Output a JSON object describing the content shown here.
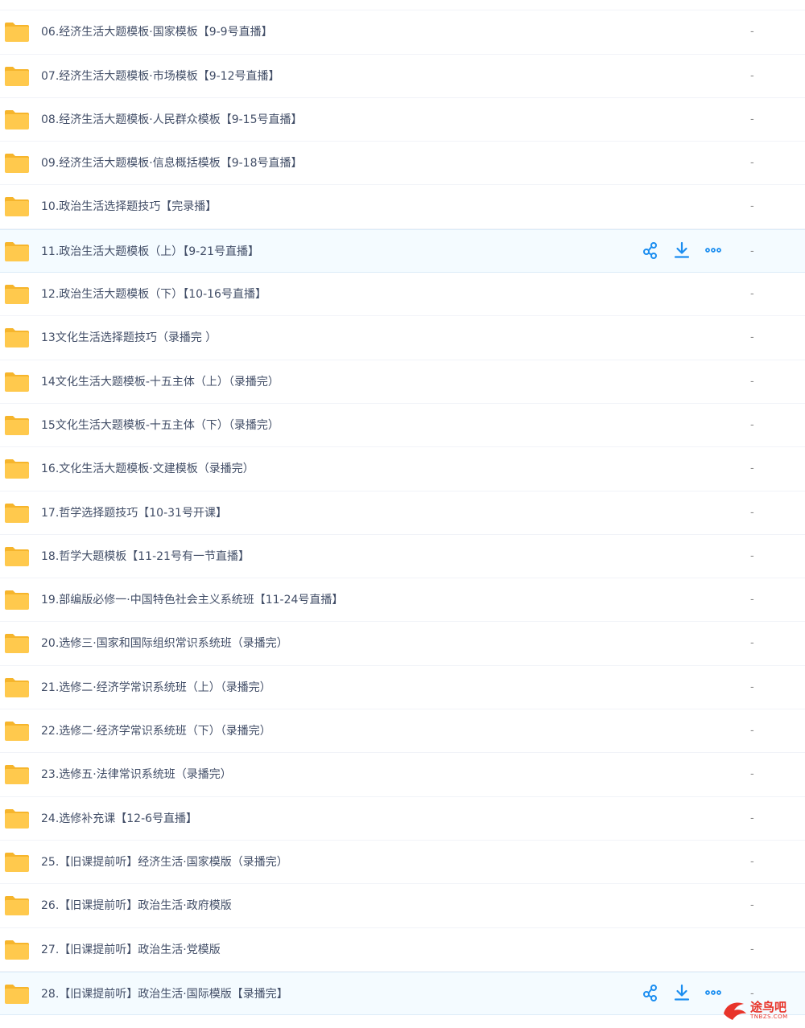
{
  "files": [
    {
      "name": "",
      "size": "",
      "icon": "folder-icon",
      "hovered": false
    },
    {
      "name": "06.经济生活大题模板·国家模板【9-9号直播】",
      "size": "-",
      "icon": "folder-icon",
      "hovered": false
    },
    {
      "name": "07.经济生活大题模板·市场模板【9-12号直播】",
      "size": "-",
      "icon": "folder-icon",
      "hovered": false
    },
    {
      "name": "08.经济生活大题模板·人民群众模板【9-15号直播】",
      "size": "-",
      "icon": "folder-icon",
      "hovered": false
    },
    {
      "name": "09.经济生活大题模板·信息概括模板【9-18号直播】",
      "size": "-",
      "icon": "folder-icon",
      "hovered": false
    },
    {
      "name": "10.政治生活选择题技巧【完录播】",
      "size": "-",
      "icon": "folder-icon",
      "hovered": false
    },
    {
      "name": "11.政治生活大题模板（上）【9-21号直播】",
      "size": "-",
      "icon": "folder-icon",
      "hovered": true
    },
    {
      "name": "12.政治生活大题模板（下）【10-16号直播】",
      "size": "-",
      "icon": "folder-icon",
      "hovered": false
    },
    {
      "name": "13文化生活选择题技巧（录播完 ）",
      "size": "-",
      "icon": "folder-icon",
      "hovered": false
    },
    {
      "name": "14文化生活大题模板-十五主体（上）（录播完）",
      "size": "-",
      "icon": "folder-icon",
      "hovered": false
    },
    {
      "name": "15文化生活大题模板-十五主体（下）（录播完）",
      "size": "-",
      "icon": "folder-icon",
      "hovered": false
    },
    {
      "name": "16.文化生活大题模板·文建模板（录播完）",
      "size": "-",
      "icon": "folder-icon",
      "hovered": false
    },
    {
      "name": "17.哲学选择题技巧【10-31号开课】",
      "size": "-",
      "icon": "folder-icon",
      "hovered": false
    },
    {
      "name": "18.哲学大题模板【11-21号有一节直播】",
      "size": "-",
      "icon": "folder-icon",
      "hovered": false
    },
    {
      "name": "19.部编版必修一·中国特色社会主义系统班【11-24号直播】",
      "size": "-",
      "icon": "folder-icon",
      "hovered": false
    },
    {
      "name": "20.选修三·国家和国际组织常识系统班（录播完）",
      "size": "-",
      "icon": "folder-icon",
      "hovered": false
    },
    {
      "name": "21.选修二·经济学常识系统班（上）（录播完）",
      "size": "-",
      "icon": "folder-icon",
      "hovered": false
    },
    {
      "name": "22.选修二·经济学常识系统班（下）（录播完）",
      "size": "-",
      "icon": "folder-icon",
      "hovered": false
    },
    {
      "name": "23.选修五·法律常识系统班（录播完）",
      "size": "-",
      "icon": "folder-icon",
      "hovered": false
    },
    {
      "name": "24.选修补充课【12-6号直播】",
      "size": "-",
      "icon": "folder-icon",
      "hovered": false
    },
    {
      "name": "25.【旧课提前听】经济生活·国家模版（录播完）",
      "size": "-",
      "icon": "folder-icon",
      "hovered": false
    },
    {
      "name": "26.【旧课提前听】政治生活·政府模版",
      "size": "-",
      "icon": "folder-icon",
      "hovered": false
    },
    {
      "name": "27.【旧课提前听】政治生活·党模版",
      "size": "-",
      "icon": "folder-icon",
      "hovered": false
    },
    {
      "name": "28.【旧课提前听】政治生活·国际模版【录播完】",
      "size": "-",
      "icon": "folder-icon",
      "hovered": true
    }
  ],
  "row_actions": [
    {
      "icon": "share-icon"
    },
    {
      "icon": "download-icon"
    },
    {
      "icon": "more-icon"
    }
  ],
  "colors": {
    "folder": "#ffc94d",
    "folder_back": "#f6b52c",
    "action": "#1a8df0",
    "text": "#424e67",
    "hover_bg": "#f4fbff"
  },
  "watermark": {
    "main": "途鸟吧",
    "sub": "TNBZS.COM",
    "icon": "bird-logo"
  }
}
